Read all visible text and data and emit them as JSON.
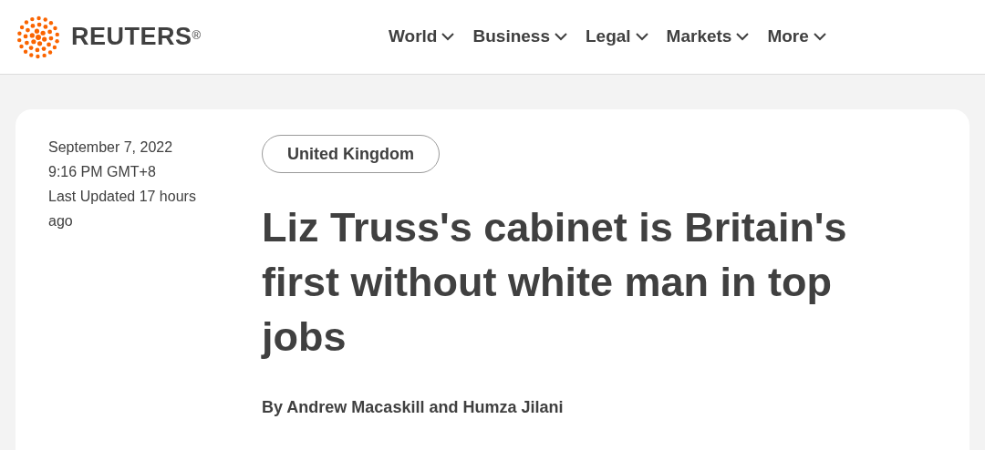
{
  "brand": {
    "name": "REUTERS",
    "mark": "®"
  },
  "nav": [
    {
      "label": "World"
    },
    {
      "label": "Business"
    },
    {
      "label": "Legal"
    },
    {
      "label": "Markets"
    },
    {
      "label": "More"
    }
  ],
  "article": {
    "meta": [
      "September 7, 2022",
      "9:16 PM GMT+8",
      "Last Updated 17 hours ago"
    ],
    "tag": "United Kingdom",
    "headline": "Liz Truss's cabinet is Britain's first without white man in top jobs",
    "byline": "By Andrew Macaskill and Humza Jilani"
  }
}
